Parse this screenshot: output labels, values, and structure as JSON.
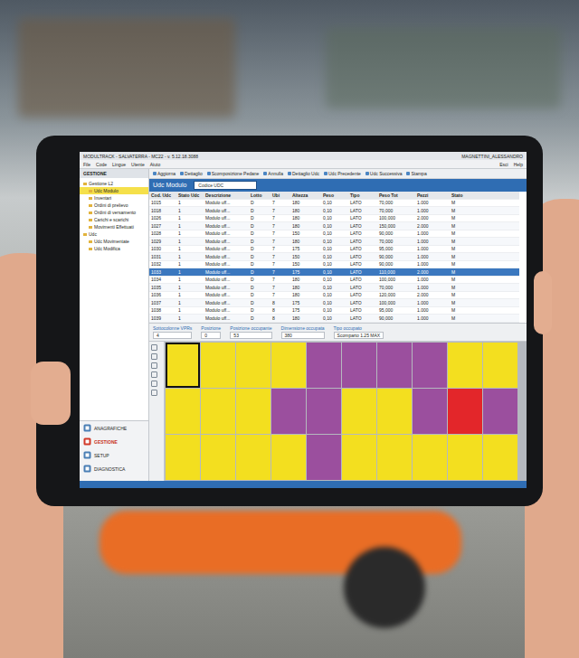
{
  "app": {
    "title": "MODULTRACK - SALVATERRA - MC22 - v. 5.12.18.3088",
    "user": "MAGNETTINI_ALESSANDRO",
    "window_buttons": [
      "Esci",
      "Help"
    ]
  },
  "menu": [
    "File",
    "Code",
    "Lingue",
    "Utente",
    "Aiuto"
  ],
  "sidebar": {
    "header": "GESTIONE",
    "tree": [
      {
        "label": "Gestione L2",
        "depth": 0,
        "selected": false
      },
      {
        "label": "Udc Modulo",
        "depth": 1,
        "selected": true
      },
      {
        "label": "Inventari",
        "depth": 1,
        "selected": false
      },
      {
        "label": "Ordini di prelievo",
        "depth": 1,
        "selected": false
      },
      {
        "label": "Ordini di versamento",
        "depth": 1,
        "selected": false
      },
      {
        "label": "Carichi e scarichi",
        "depth": 1,
        "selected": false
      },
      {
        "label": "Movimenti Effettuati",
        "depth": 1,
        "selected": false
      },
      {
        "label": "Udc",
        "depth": 0,
        "selected": false
      },
      {
        "label": "Udc Movimentate",
        "depth": 1,
        "selected": false
      },
      {
        "label": "Udc Modifica",
        "depth": 1,
        "selected": false
      }
    ],
    "nav": [
      {
        "label": "ANAGRAFICHE",
        "selected": false
      },
      {
        "label": "GESTIONE",
        "selected": true
      },
      {
        "label": "SETUP",
        "selected": false
      },
      {
        "label": "DIAGNOSTICA",
        "selected": false
      }
    ]
  },
  "toolbar": [
    "Aggiorna",
    "Dettaglio",
    "Scomposizione Pedane",
    "Annulla",
    "Dettaglio Udc",
    "Udc Precedente",
    "Udc Successiva",
    "Stampa"
  ],
  "panel": {
    "title": "Udc Modulo",
    "filter": "Codice UDC"
  },
  "table": {
    "columns": [
      "Cod. Udc",
      "Stato Udc",
      "Descrizione",
      "Lotto",
      "Ubi",
      "Altezza",
      "Peso",
      "Tipo",
      "Peso Tot",
      "Pezzi",
      "Stato"
    ],
    "rows": [
      {
        "cells": [
          "1015",
          "1",
          "Modulo uff...",
          "D",
          "7",
          "180",
          "0,10",
          "LATO",
          "70,000",
          "1.000",
          "M"
        ],
        "selected": false
      },
      {
        "cells": [
          "1018",
          "1",
          "Modulo uff...",
          "D",
          "7",
          "180",
          "0,10",
          "LATO",
          "70,000",
          "1.000",
          "M"
        ],
        "selected": false
      },
      {
        "cells": [
          "1026",
          "1",
          "Modulo uff...",
          "D",
          "7",
          "180",
          "0,10",
          "LATO",
          "100,000",
          "2.000",
          "M"
        ],
        "selected": false
      },
      {
        "cells": [
          "1027",
          "1",
          "Modulo uff...",
          "D",
          "7",
          "180",
          "0,10",
          "LATO",
          "150,000",
          "2.000",
          "M"
        ],
        "selected": false
      },
      {
        "cells": [
          "1028",
          "1",
          "Modulo uff...",
          "D",
          "7",
          "150",
          "0,10",
          "LATO",
          "90,000",
          "1.000",
          "M"
        ],
        "selected": false
      },
      {
        "cells": [
          "1029",
          "1",
          "Modulo uff...",
          "D",
          "7",
          "180",
          "0,10",
          "LATO",
          "70,000",
          "1.000",
          "M"
        ],
        "selected": false
      },
      {
        "cells": [
          "1030",
          "1",
          "Modulo uff...",
          "D",
          "7",
          "175",
          "0,10",
          "LATO",
          "95,000",
          "1.000",
          "M"
        ],
        "selected": false
      },
      {
        "cells": [
          "1031",
          "1",
          "Modulo uff...",
          "D",
          "7",
          "150",
          "0,10",
          "LATO",
          "90,000",
          "1.000",
          "M"
        ],
        "selected": false
      },
      {
        "cells": [
          "1032",
          "1",
          "Modulo uff...",
          "D",
          "7",
          "150",
          "0,10",
          "LATO",
          "90,000",
          "1.000",
          "M"
        ],
        "selected": false
      },
      {
        "cells": [
          "1033",
          "1",
          "Modulo uff...",
          "D",
          "7",
          "175",
          "0,10",
          "LATO",
          "110,000",
          "2.000",
          "M"
        ],
        "selected": true
      },
      {
        "cells": [
          "1034",
          "1",
          "Modulo uff...",
          "D",
          "7",
          "180",
          "0,10",
          "LATO",
          "100,000",
          "1.000",
          "M"
        ],
        "selected": false
      },
      {
        "cells": [
          "1035",
          "1",
          "Modulo uff...",
          "D",
          "7",
          "180",
          "0,10",
          "LATO",
          "70,000",
          "1.000",
          "M"
        ],
        "selected": false
      },
      {
        "cells": [
          "1036",
          "1",
          "Modulo uff...",
          "D",
          "7",
          "180",
          "0,10",
          "LATO",
          "120,000",
          "2.000",
          "M"
        ],
        "selected": false
      },
      {
        "cells": [
          "1037",
          "1",
          "Modulo uff...",
          "D",
          "8",
          "175",
          "0,10",
          "LATO",
          "100,000",
          "1.000",
          "M"
        ],
        "selected": false
      },
      {
        "cells": [
          "1038",
          "1",
          "Modulo uff...",
          "D",
          "8",
          "175",
          "0,10",
          "LATO",
          "95,000",
          "1.000",
          "M"
        ],
        "selected": false
      },
      {
        "cells": [
          "1039",
          "1",
          "Modulo uff...",
          "D",
          "8",
          "180",
          "0,10",
          "LATO",
          "90,000",
          "1.000",
          "M"
        ],
        "selected": false
      }
    ]
  },
  "fields": [
    {
      "label": "Sottocolonne VPRs",
      "value": "4"
    },
    {
      "label": "Posizione",
      "value": "0"
    },
    {
      "label": "Posizione occupante",
      "value": "53"
    },
    {
      "label": "Dimensione occupata",
      "value": "380"
    },
    {
      "label": "Tipo occupato",
      "value": "Scomparto 1.25 MAX"
    }
  ],
  "grid": {
    "rows": [
      [
        {
          "color": "#f3df1f",
          "selected": true
        },
        {
          "color": "#f3df1f",
          "selected": false
        },
        {
          "color": "#f3df1f",
          "selected": false
        },
        {
          "color": "#f3df1f",
          "selected": false
        },
        {
          "color": "#9b4f9e",
          "selected": false
        },
        {
          "color": "#9b4f9e",
          "selected": false
        },
        {
          "color": "#9b4f9e",
          "selected": false
        },
        {
          "color": "#9b4f9e",
          "selected": false
        },
        {
          "color": "#f3df1f",
          "selected": false
        },
        {
          "color": "#f3df1f",
          "selected": false
        }
      ],
      [
        {
          "color": "#f3df1f",
          "selected": false
        },
        {
          "color": "#f3df1f",
          "selected": false
        },
        {
          "color": "#f3df1f",
          "selected": false
        },
        {
          "color": "#9b4f9e",
          "selected": false
        },
        {
          "color": "#9b4f9e",
          "selected": false
        },
        {
          "color": "#f3df1f",
          "selected": false
        },
        {
          "color": "#f3df1f",
          "selected": false
        },
        {
          "color": "#9b4f9e",
          "selected": false
        },
        {
          "color": "#e3262a",
          "selected": false
        },
        {
          "color": "#9b4f9e",
          "selected": false
        }
      ],
      [
        {
          "color": "#f3df1f",
          "selected": false
        },
        {
          "color": "#f3df1f",
          "selected": false
        },
        {
          "color": "#f3df1f",
          "selected": false
        },
        {
          "color": "#f3df1f",
          "selected": false
        },
        {
          "color": "#9b4f9e",
          "selected": false
        },
        {
          "color": "#f3df1f",
          "selected": false
        },
        {
          "color": "#f3df1f",
          "selected": false
        },
        {
          "color": "#f3df1f",
          "selected": false
        },
        {
          "color": "#f3df1f",
          "selected": false
        },
        {
          "color": "#f3df1f",
          "selected": false
        }
      ]
    ]
  }
}
